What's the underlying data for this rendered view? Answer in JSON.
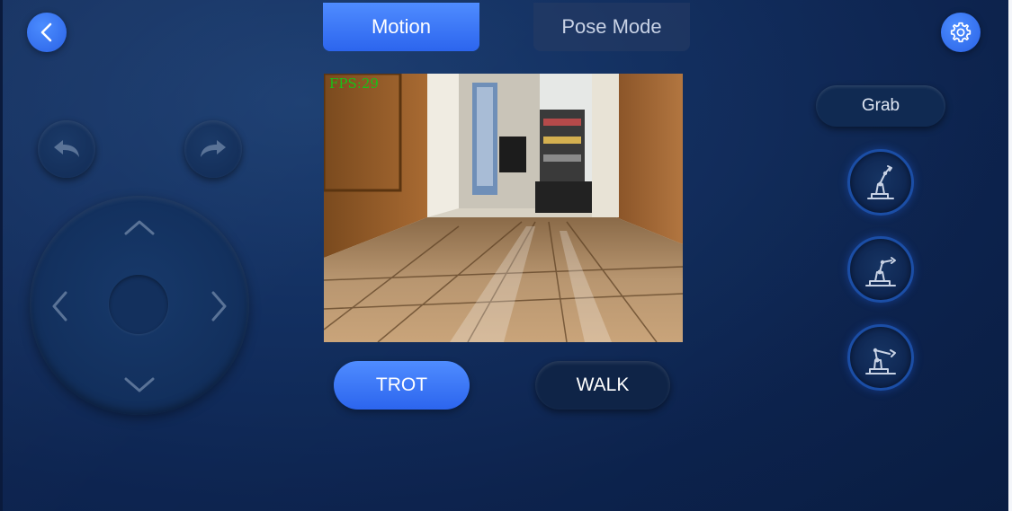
{
  "header": {
    "tabs": [
      {
        "label": "Motion",
        "active": true
      },
      {
        "label": "Pose Mode",
        "active": false
      }
    ],
    "back_icon": "chevron-left-icon",
    "settings_icon": "gear-icon"
  },
  "camera": {
    "fps_text": "FPS:29"
  },
  "gait": {
    "trot_label": "TROT",
    "walk_label": "WALK",
    "selected": "TROT"
  },
  "arm": {
    "grab_label": "Grab",
    "poses": [
      "robot-arm-pose-1-icon",
      "robot-arm-pose-2-icon",
      "robot-arm-pose-3-icon"
    ]
  },
  "controls": {
    "turn_left_icon": "undo-arrow-icon",
    "turn_right_icon": "redo-arrow-icon",
    "dpad": [
      "up",
      "down",
      "left",
      "right"
    ]
  },
  "colors": {
    "accent": "#3a78f5",
    "background": "#133061",
    "fps_green": "#18c018"
  }
}
